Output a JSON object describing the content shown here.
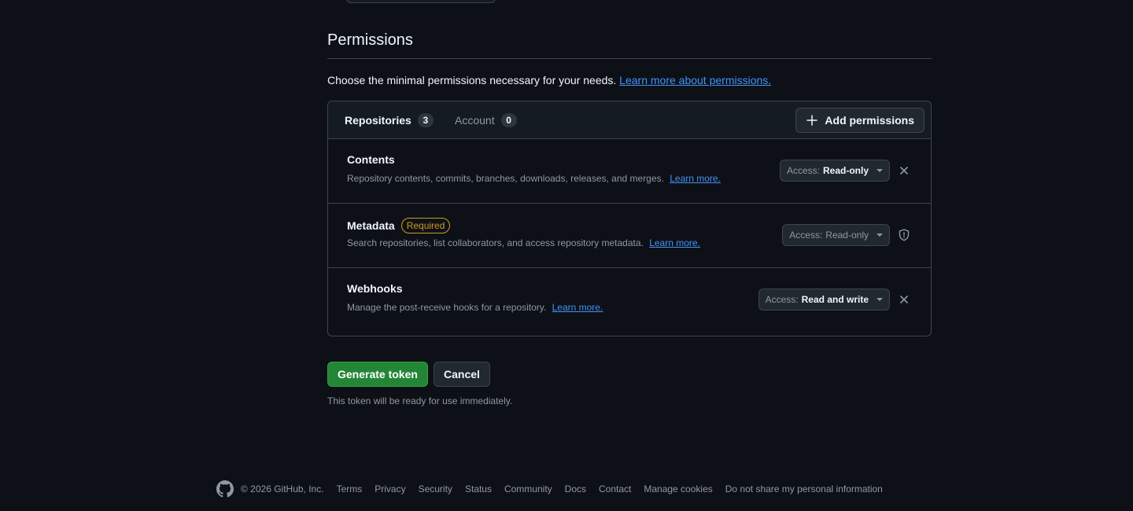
{
  "permissions": {
    "title": "Permissions",
    "intro": "Choose the minimal permissions necessary for your needs.",
    "learn_more": "Learn more about permissions.",
    "tabs": [
      {
        "label": "Repositories",
        "count": "3"
      },
      {
        "label": "Account",
        "count": "0"
      }
    ],
    "add_button": "Add permissions",
    "rows": [
      {
        "title": "Contents",
        "badge": "",
        "description": "Repository contents, commits, branches, downloads, releases, and merges.",
        "learn_more": "Learn more.",
        "access_prefix": "Access:",
        "access_value": "Read-only",
        "action_icon": "x-icon"
      },
      {
        "title": "Metadata",
        "badge": "Required",
        "description": "Search repositories, list collaborators, and access repository metadata.",
        "learn_more": "Learn more.",
        "access_prefix": "Access:",
        "access_value": "Read-only",
        "action_icon": "shield-icon"
      },
      {
        "title": "Webhooks",
        "badge": "",
        "description": "Manage the post-receive hooks for a repository.",
        "learn_more": "Learn more.",
        "access_prefix": "Access:",
        "access_value": "Read and write",
        "action_icon": "x-icon"
      }
    ]
  },
  "actions": {
    "generate": "Generate token",
    "cancel": "Cancel",
    "hint": "This token will be ready for use immediately."
  },
  "footer": {
    "copyright": "© 2026 GitHub, Inc.",
    "links": [
      "Terms",
      "Privacy",
      "Security",
      "Status",
      "Community",
      "Docs",
      "Contact",
      "Manage cookies",
      "Do not share my personal information"
    ]
  },
  "colors": {
    "background": "#0d1117",
    "primary_button": "#238636",
    "link": "#4493f8",
    "required_badge": "#d29922"
  }
}
